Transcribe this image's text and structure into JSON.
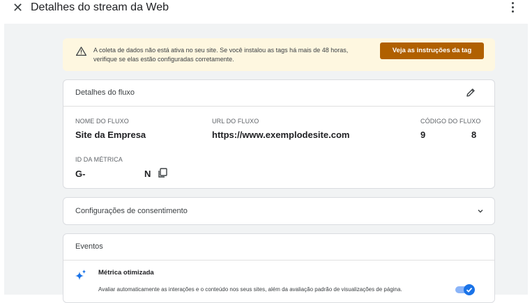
{
  "header": {
    "close_icon": "close-icon",
    "title": "Detalhes do stream da Web",
    "menu_icon": "more-vert-icon"
  },
  "alert": {
    "icon": "warning-icon",
    "text": "A coleta de dados não está ativa no seu site. Se você instalou as tags há mais de 48 horas, verifique se elas estão configuradas corretamente.",
    "button_label": "Veja as instruções da tag",
    "button_color": "#b06000"
  },
  "stream_details": {
    "title": "Detalhes do fluxo",
    "name_label": "NOME DO FLUXO",
    "name_value": "Site da Empresa",
    "url_label": "URL DO FLUXO",
    "url_value": "https://www.exemplodesite.com",
    "code_label": "CÓDIGO DO FLUXO",
    "code_value_start": "9",
    "code_value_end": "8",
    "metric_id_label": "ID DA MÉTRICA",
    "metric_id_start": "G-",
    "metric_id_end": "N"
  },
  "consent": {
    "title": "Configurações de consentimento"
  },
  "events": {
    "title": "Eventos",
    "metric_title": "Métrica otimizada",
    "metric_description": "Avaliar automaticamente as interações e o conteúdo nos seus sites, além da avaliação padrão de visualizações de página.",
    "toggle_on": true,
    "accent_color": "#1a73e8"
  }
}
